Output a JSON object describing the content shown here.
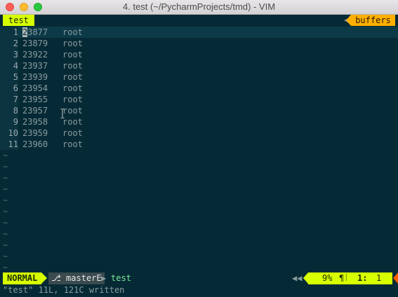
{
  "window": {
    "title": "4. test (~/PycharmProjects/tmd) - VIM"
  },
  "tabline": {
    "active_tab": "test",
    "buffers_label": "buffers",
    "buffers_arrow": "◀"
  },
  "buffer": {
    "lines": [
      {
        "num": "1",
        "pid_first": "2",
        "pid_rest": "3877",
        "user": "root"
      },
      {
        "num": "2",
        "pid": "23879",
        "user": "root"
      },
      {
        "num": "3",
        "pid": "23922",
        "user": "root"
      },
      {
        "num": "4",
        "pid": "23937",
        "user": "root"
      },
      {
        "num": "5",
        "pid": "23939",
        "user": "root"
      },
      {
        "num": "6",
        "pid": "23954",
        "user": "root"
      },
      {
        "num": "7",
        "pid": "23955",
        "user": "root"
      },
      {
        "num": "8",
        "pid": "23957",
        "user": "root"
      },
      {
        "num": "9",
        "pid": "23958",
        "user": "root"
      },
      {
        "num": "10",
        "pid": "23959",
        "user": "root"
      },
      {
        "num": "11",
        "pid": "23960",
        "user": "root"
      }
    ],
    "tilde": "~"
  },
  "statusline": {
    "mode": "NORMAL",
    "branch": "⎇ master",
    "branch_flag": "E",
    "branch_sep": "▶",
    "filename": "test",
    "right_arrows": "◀◀",
    "percent": "9%",
    "pilcrow": "¶",
    "sep": "▏",
    "line": "1:",
    "col": "1"
  },
  "cmdline": {
    "message": "\"test\" 11L, 121C written"
  },
  "colors": {
    "background": "#062a35",
    "mode_accent": "#d7ff00",
    "buffers_accent": "#ffaf00",
    "filename": "#78e89a",
    "warning": "#ff5f00"
  }
}
